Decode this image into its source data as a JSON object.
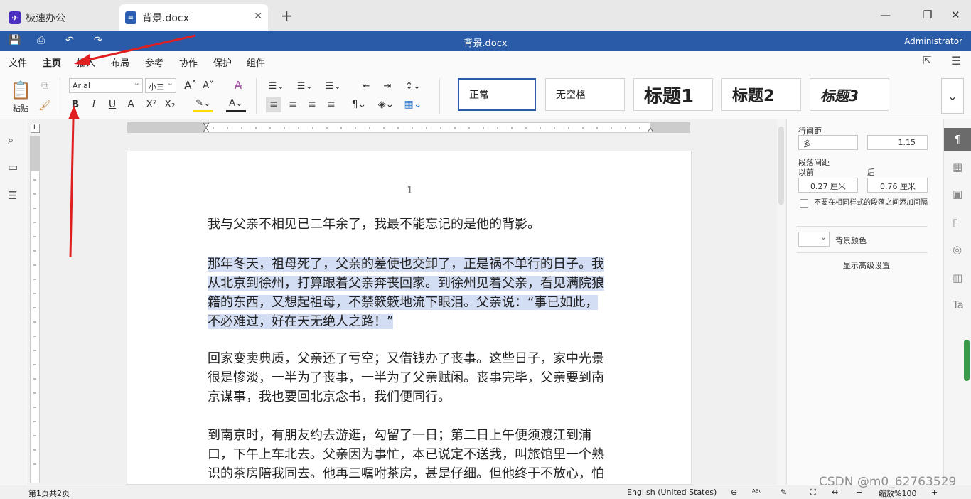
{
  "tabs": [
    {
      "label": "极速办公"
    },
    {
      "label": "背景.docx"
    }
  ],
  "title": {
    "doc": "背景.docx",
    "user": "Administrator"
  },
  "menu": [
    "文件",
    "主页",
    "插入",
    "布局",
    "参考",
    "协作",
    "保护",
    "组件"
  ],
  "ribbon": {
    "paste": "粘贴",
    "font_name": "Arial",
    "font_size": "小三",
    "styles": [
      "正常",
      "无空格",
      "标题1",
      "标题2",
      "标题3"
    ]
  },
  "document": {
    "page_number": "1",
    "paragraphs": [
      [
        "我与父亲不相见已二年余了，我最不能忘记的是他的背影。"
      ],
      [
        "那年冬天，祖母死了，父亲的差使也交卸了，正是祸不单行的日子。我",
        "从北京到徐州，打算跟着父亲奔丧回家。到徐州见着父亲，看见满院狼",
        "籍的东西，又想起祖母，不禁簌簌地流下眼泪。父亲说：“事已如此，",
        "不必难过，好在天无绝人之路！”"
      ],
      [
        "回家变卖典质，父亲还了亏空；又借钱办了丧事。这些日子，家中光景",
        "很是惨淡，一半为了丧事，一半为了父亲赋闲。丧事完毕，父亲要到南",
        "京谋事，我也要回北京念书，我们便同行。"
      ],
      [
        "到南京时，有朋友约去游逛，勾留了一日；第二日上午便须渡江到浦",
        "口，下午上车北去。父亲因为事忙，本已说定不送我，叫旅馆里一个熟",
        "识的茶房陪我同去。他再三嘱咐茶房，甚是仔细。但他终于不放心，怕"
      ]
    ]
  },
  "panel": {
    "line_spacing_label": "行间距",
    "line_spacing_mode": "多",
    "line_spacing_value": "1.15",
    "para_spacing_label": "段落间距",
    "before_label": "以前",
    "after_label": "后",
    "before_value": "0.27 厘米",
    "after_value": "0.76 厘米",
    "no_space_label": "不要在相同样式的段落之间添加间隔",
    "bg_color_label": "背景颜色",
    "advanced_link": "显示高级设置"
  },
  "status": {
    "page_info": "第1页共2页",
    "language": "English (United States)",
    "zoom": "缩放%100",
    "watermark": "CSDN @m0_62763529"
  }
}
